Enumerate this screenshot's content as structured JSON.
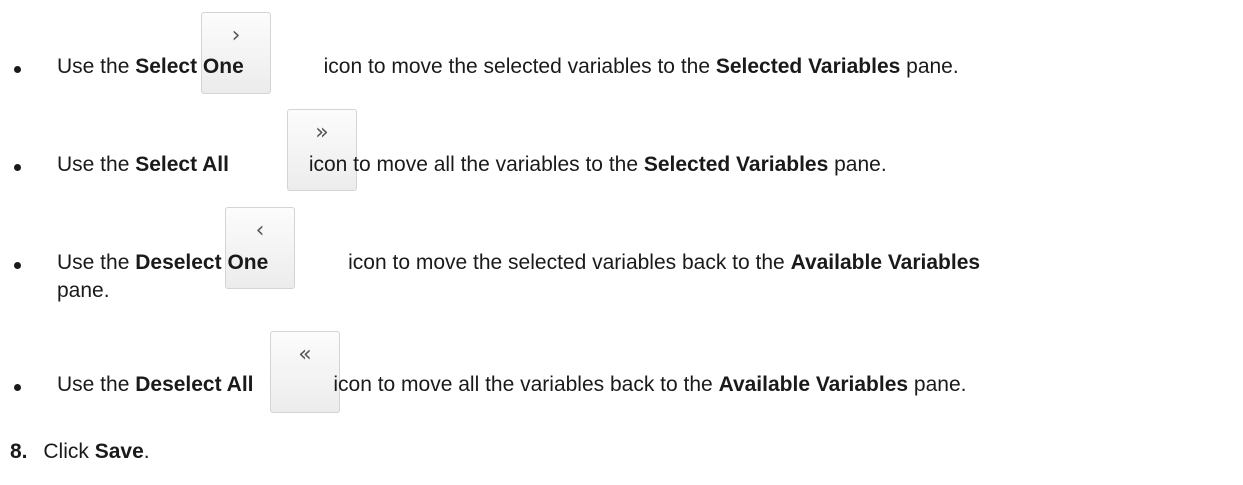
{
  "items": [
    {
      "pre": "Use the ",
      "bold": "Select One",
      "icon_glyph": "›",
      "icon_name": "select-one-icon",
      "post": "icon to move the selected variables to the ",
      "target": "Selected Variables",
      "tail": " pane."
    },
    {
      "pre": "Use the ",
      "bold": "Select All",
      "icon_glyph": "»",
      "icon_name": "select-all-icon",
      "post": "icon to move all the variables to the ",
      "target": "Selected Variables",
      "tail": " pane."
    },
    {
      "pre": "Use the ",
      "bold": "Deselect One",
      "icon_glyph": "‹",
      "icon_name": "deselect-one-icon",
      "post": "icon to move the selected variables back to the ",
      "target": "Available Variables",
      "tail": "",
      "continuation": "pane."
    },
    {
      "pre": "Use the ",
      "bold": "Deselect All",
      "icon_glyph": "«",
      "icon_name": "deselect-all-icon",
      "post": "icon to move all the variables back to the ",
      "target": "Available Variables",
      "tail": " pane."
    }
  ],
  "step": {
    "number": "8.",
    "pre": "Click ",
    "bold": "Save",
    "tail": "."
  }
}
